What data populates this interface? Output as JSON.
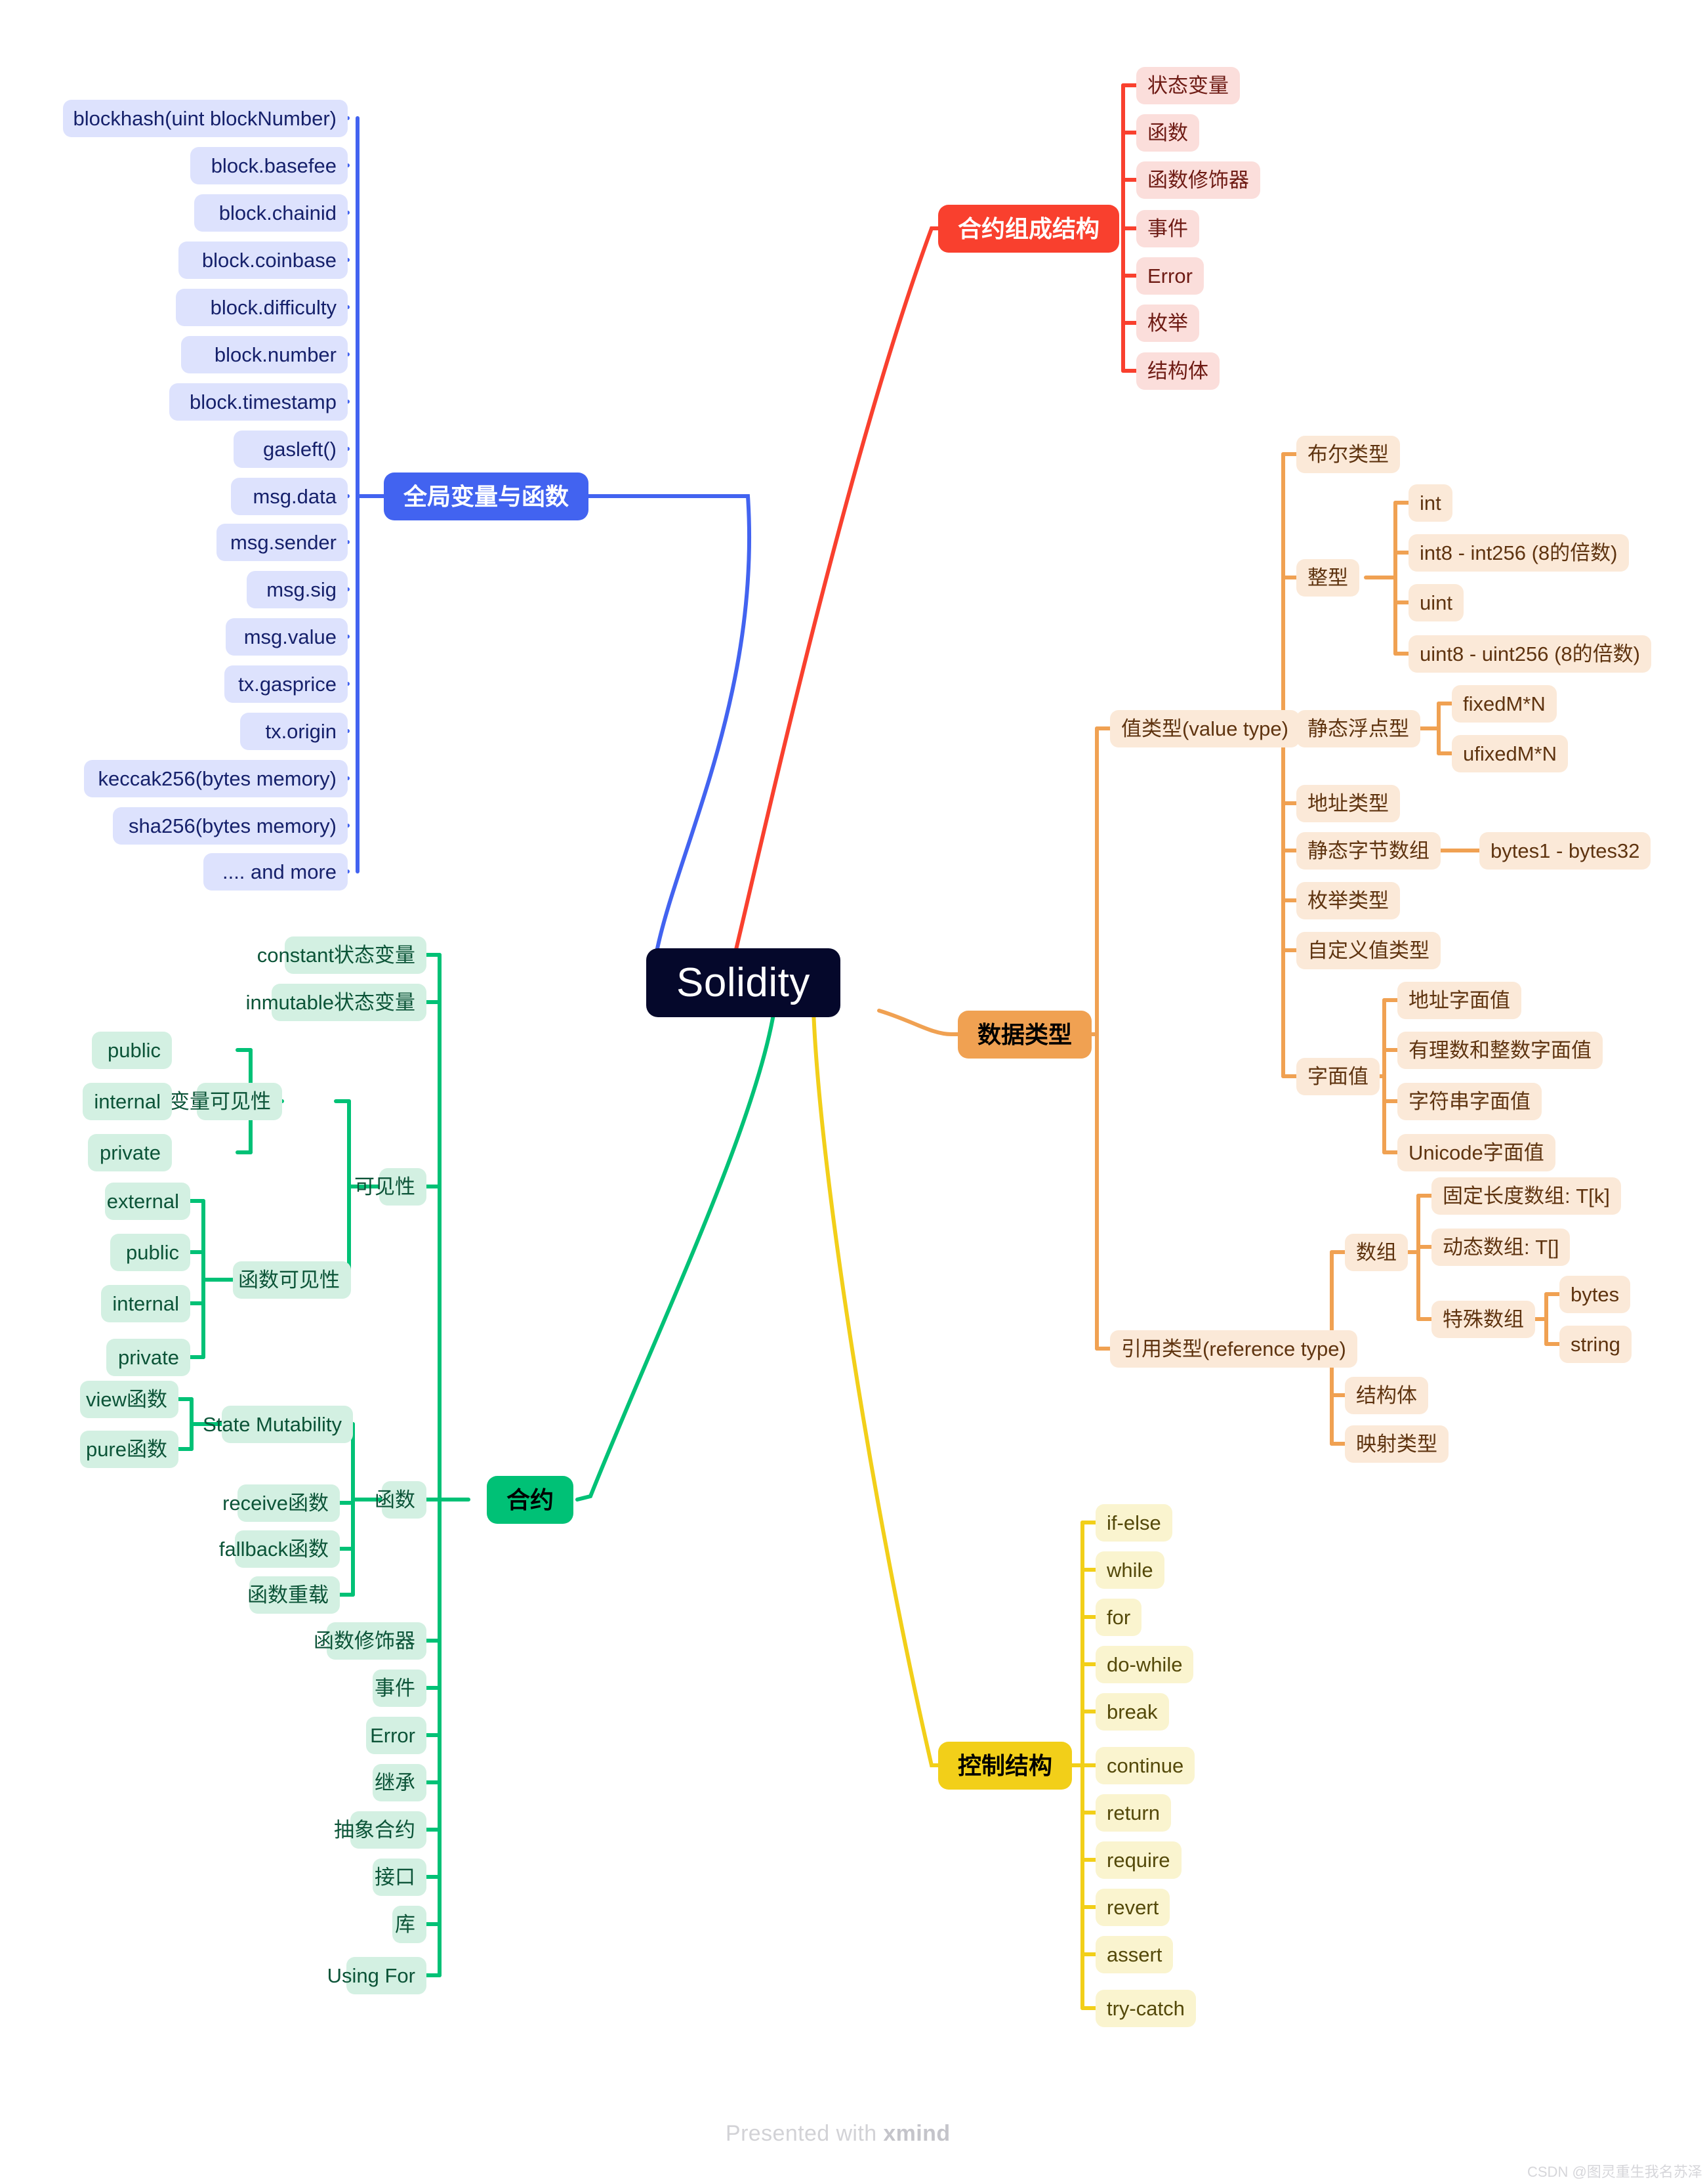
{
  "title": "Solidity",
  "colors": {
    "root_bg": "#05082b",
    "blue": "#4263f0",
    "red": "#f9402e",
    "orange": "#f0a152",
    "green": "#00c176",
    "yellow": "#f2cf19",
    "blue_leaf": "#dde2fd",
    "red_leaf": "#fbdedb",
    "orange_leaf": "#fbe9d8",
    "green_leaf": "#d3f0e2",
    "yellow_leaf": "#faf4cf"
  },
  "branches": {
    "globals": {
      "label": "全局变量与函数",
      "children": [
        "blockhash(uint blockNumber)",
        "block.basefee",
        "block.chainid",
        "block.coinbase",
        "block.difficulty",
        "block.number",
        "block.timestamp",
        "gasleft()",
        "msg.data",
        "msg.sender",
        "msg.sig",
        "msg.value",
        "tx.gasprice",
        "tx.origin",
        "keccak256(bytes memory)",
        "sha256(bytes memory)",
        ".... and more"
      ]
    },
    "contract_structure": {
      "label": "合约组成结构",
      "children": [
        "状态变量",
        "函数",
        "函数修饰器",
        "事件",
        "Error",
        "枚举",
        "结构体"
      ]
    },
    "data_types": {
      "label": "数据类型",
      "value_type": {
        "label": "值类型(value type)",
        "children": [
          {
            "label": "布尔类型"
          },
          {
            "label": "整型",
            "children": [
              "int",
              "int8 - int256 (8的倍数)",
              "uint",
              "uint8 - uint256 (8的倍数)"
            ]
          },
          {
            "label": "静态浮点型",
            "children": [
              "fixedM*N",
              "ufixedM*N"
            ]
          },
          {
            "label": "地址类型"
          },
          {
            "label": "静态字节数组",
            "children": [
              "bytes1 - bytes32"
            ]
          },
          {
            "label": "枚举类型"
          },
          {
            "label": "自定义值类型"
          },
          {
            "label": "字面值",
            "children": [
              "地址字面值",
              "有理数和整数字面值",
              "字符串字面值",
              "Unicode字面值"
            ]
          }
        ]
      },
      "reference_type": {
        "label": "引用类型(reference type)",
        "children": [
          {
            "label": "数组",
            "children": [
              {
                "label": "固定长度数组: T[k]"
              },
              {
                "label": "动态数组: T[]"
              },
              {
                "label": "特殊数组",
                "children": [
                  "bytes",
                  "string"
                ]
              }
            ]
          },
          {
            "label": "结构体"
          },
          {
            "label": "映射类型"
          }
        ]
      }
    },
    "contract": {
      "label": "合约",
      "visibility": {
        "label": "可见性",
        "state_var_visibility": {
          "label": "状态变量可见性",
          "children": [
            "public",
            "internal",
            "private"
          ]
        },
        "function_visibility": {
          "label": "函数可见性",
          "children": [
            "external",
            "public",
            "internal",
            "private"
          ]
        }
      },
      "state_vars": [
        "constant状态变量",
        "inmutable状态变量"
      ],
      "function": {
        "label": "函数",
        "state_mutability": {
          "label": "State Mutability",
          "children": [
            "view函数",
            "pure函数"
          ]
        },
        "children": [
          "receive函数",
          "fallback函数",
          "函数重载"
        ]
      },
      "others": [
        "函数修饰器",
        "事件",
        "Error",
        "继承",
        "抽象合约",
        "接口",
        "库",
        "Using For"
      ]
    },
    "control": {
      "label": "控制结构",
      "children": [
        "if-else",
        "while",
        "for",
        "do-while",
        "break",
        "continue",
        "return",
        "require",
        "revert",
        "assert",
        "try-catch"
      ]
    }
  },
  "footer": {
    "xmind_prefix": "Presented with ",
    "xmind_brand": "xmind",
    "csdn": "CSDN @图灵重生我名苏泽"
  }
}
